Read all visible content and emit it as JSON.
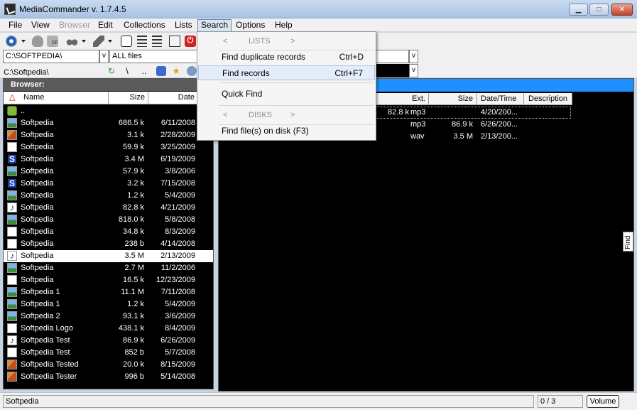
{
  "window": {
    "title": "MediaCommander v. 1.7.4.5",
    "minimize": "▁",
    "maximize": "□",
    "close": "✕"
  },
  "menubar": [
    "File",
    "View",
    "Browser",
    "Edit",
    "Collections",
    "Lists",
    "Search",
    "Options",
    "Help"
  ],
  "menubar_state": {
    "disabled": "Browser",
    "open": "Search"
  },
  "filter": {
    "path": "C:\\SOFTPEDIA\\",
    "filter": "ALL files",
    "arrow": "v"
  },
  "current_path": "C:\\Softpedia\\",
  "browser": {
    "header": "Browser:",
    "columns": {
      "sort": "△",
      "name": "Name",
      "size": "Size",
      "date": "Date"
    },
    "up_entry": "..",
    "files": [
      {
        "name": "Softpedia",
        "size": "686.5 k",
        "date": "6/11/2008",
        "icon": "image-file-icon"
      },
      {
        "name": "Softpedia",
        "size": "3.1 k",
        "date": "2/28/2009",
        "icon": "picture-file-icon"
      },
      {
        "name": "Softpedia",
        "size": "59.9 k",
        "date": "3/25/2009",
        "icon": "document-file-icon"
      },
      {
        "name": "Softpedia",
        "size": "3.4 M",
        "date": "6/19/2009",
        "icon": "s-app-icon"
      },
      {
        "name": "Softpedia",
        "size": "57.9 k",
        "date": "3/8/2006",
        "icon": "image-file-icon"
      },
      {
        "name": "Softpedia",
        "size": "3.2 k",
        "date": "7/15/2008",
        "icon": "s-app-icon"
      },
      {
        "name": "Softpedia",
        "size": "1.2 k",
        "date": "5/4/2009",
        "icon": "image-file-icon"
      },
      {
        "name": "Softpedia",
        "size": "82.8 k",
        "date": "4/21/2009",
        "icon": "music-note-icon"
      },
      {
        "name": "Softpedia",
        "size": "818.0 k",
        "date": "5/8/2008",
        "icon": "image-file-icon"
      },
      {
        "name": "Softpedia",
        "size": "34.8 k",
        "date": "8/3/2009",
        "icon": "document-file-icon"
      },
      {
        "name": "Softpedia",
        "size": "238 b",
        "date": "4/14/2008",
        "icon": "document-file-icon"
      },
      {
        "name": "Softpedia",
        "size": "3.5 M",
        "date": "2/13/2009",
        "icon": "music-note-icon",
        "selected": true
      },
      {
        "name": "Softpedia",
        "size": "2.7 M",
        "date": "11/2/2006",
        "icon": "image-file-icon"
      },
      {
        "name": "Softpedia",
        "size": "16.5 k",
        "date": "12/23/2009",
        "icon": "document-file-icon"
      },
      {
        "name": "Softpedia 1",
        "size": "11.1 M",
        "date": "7/11/2008",
        "icon": "image-file-icon"
      },
      {
        "name": "Softpedia 1",
        "size": "1.2 k",
        "date": "5/4/2009",
        "icon": "image-file-icon"
      },
      {
        "name": "Softpedia 2",
        "size": "93.1 k",
        "date": "3/6/2009",
        "icon": "image-file-icon"
      },
      {
        "name": "Softpedia Logo",
        "size": "438.1 k",
        "date": "8/4/2009",
        "icon": "document-file-icon"
      },
      {
        "name": "Softpedia Test",
        "size": "86.9 k",
        "date": "6/26/2009",
        "icon": "music-note-icon"
      },
      {
        "name": "Softpedia Test",
        "size": "852 b",
        "date": "5/7/2008",
        "icon": "document-file-icon"
      },
      {
        "name": "Softpedia Tested",
        "size": "20.0 k",
        "date": "8/15/2009",
        "icon": "picture-file-icon"
      },
      {
        "name": "Softpedia Tester",
        "size": "996 b",
        "date": "5/14/2008",
        "icon": "picture-file-icon"
      }
    ]
  },
  "records": {
    "columns": {
      "ext": "Ext.",
      "size": "Size",
      "datetime": "Date/Time",
      "description": "Description"
    },
    "rows": [
      {
        "ext": "mp3",
        "size": "82.8 k",
        "datetime": "4/20/200..."
      },
      {
        "ext": "mp3",
        "size": "86.9 k",
        "datetime": "6/26/200..."
      },
      {
        "ext": "wav",
        "size": "3.5 M",
        "datetime": "2/13/200..."
      }
    ]
  },
  "search_menu": {
    "lists_header": {
      "left": "<",
      "label": "LISTS",
      "right": ">"
    },
    "find_duplicate": {
      "label": "Find duplicate records",
      "shortcut": "Ctrl+D"
    },
    "find_records": {
      "label": "Find records",
      "shortcut": "Ctrl+F7"
    },
    "quick_find": {
      "label": "Quick Find"
    },
    "disks_header": {
      "left": "<",
      "label": "DISKS",
      "right": ">"
    },
    "find_files": {
      "label": "Find file(s) on disk  (F3)"
    }
  },
  "find_tab": "Find",
  "status": {
    "left": "Softpedia",
    "count": "0 / 3",
    "volume_button": "Volume"
  },
  "toolbar_icons": [
    "gear-icon",
    "cloud-icon",
    "df-icon",
    "binoculars-icon",
    "eraser-icon",
    "database-icon",
    "tree-icon",
    "book-icon",
    "power-icon"
  ],
  "toolbar_labels": {
    "power": "⏻"
  },
  "path_icons": {
    "refresh": "↻",
    "back": "\\",
    "parent": "..",
    "star": "★"
  },
  "colors": {
    "accent_blue": "#1e90ff",
    "panel_bg": "#000000",
    "menu_highlight": "#e3ecf8"
  }
}
